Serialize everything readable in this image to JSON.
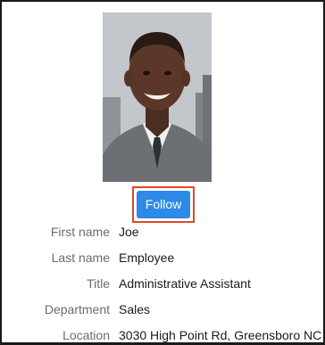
{
  "profile": {
    "photo_icon": "person-photo",
    "follow_label": "Follow",
    "fields": [
      {
        "label": "First name",
        "value": "Joe"
      },
      {
        "label": "Last name",
        "value": "Employee"
      },
      {
        "label": "Title",
        "value": "Administrative Assistant"
      },
      {
        "label": "Department",
        "value": "Sales"
      },
      {
        "label": "Location",
        "value": "3030 High Point Rd, Greensboro NC"
      }
    ]
  },
  "colors": {
    "follow_button": "#2e8ae8",
    "highlight_border": "#e0472b",
    "label_text": "#6b6b6b",
    "value_text": "#1a1a1a"
  }
}
